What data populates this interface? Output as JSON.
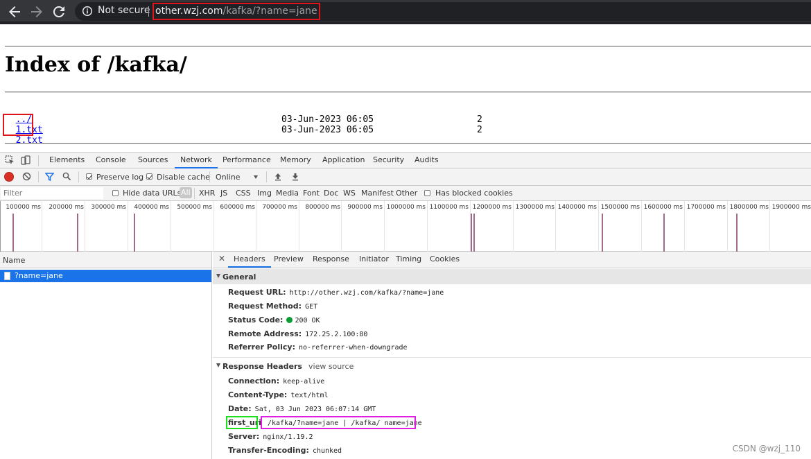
{
  "browser": {
    "security_label": "Not secure",
    "url_host": "other.wzj.com",
    "url_path": "/kafka/?name=jane",
    "icons": [
      "back-arrow-icon",
      "forward-arrow-icon",
      "reload-icon",
      "info-icon"
    ]
  },
  "page": {
    "heading": "Index of /kafka/",
    "entries": [
      {
        "name": "../",
        "date": "",
        "size": ""
      },
      {
        "name": "1.txt",
        "date": "03-Jun-2023 06:05",
        "size": "2"
      },
      {
        "name": "2.txt",
        "date": "03-Jun-2023 06:05",
        "size": "2"
      }
    ]
  },
  "devtools": {
    "tabs": [
      "Elements",
      "Console",
      "Sources",
      "Network",
      "Performance",
      "Memory",
      "Application",
      "Security",
      "Audits"
    ],
    "active_tab": "Network",
    "toolbar": {
      "preserve_log": "Preserve log",
      "preserve_log_checked": true,
      "disable_cache": "Disable cache",
      "disable_cache_checked": true,
      "throttle": "Online"
    },
    "filter": {
      "placeholder": "Filter",
      "hide_data_urls": "Hide data URLs",
      "types": [
        "All",
        "XHR",
        "JS",
        "CSS",
        "Img",
        "Media",
        "Font",
        "Doc",
        "WS",
        "Manifest",
        "Other"
      ],
      "active_type": "All",
      "has_blocked_cookies": "Has blocked cookies"
    },
    "timeline": {
      "labels": [
        "100000 ms",
        "200000 ms",
        "300000 ms",
        "400000 ms",
        "500000 ms",
        "600000 ms",
        "700000 ms",
        "800000 ms",
        "900000 ms",
        "1000000 ms",
        "1100000 ms",
        "1200000 ms",
        "1300000 ms",
        "1400000 ms",
        "1500000 ms",
        "1600000 ms",
        "1700000 ms",
        "1800000 ms",
        "1900000 ms"
      ]
    },
    "name_column": "Name",
    "request": "?name=jane",
    "detail_tabs": [
      "Headers",
      "Preview",
      "Response",
      "Initiator",
      "Timing",
      "Cookies"
    ],
    "active_detail_tab": "Headers",
    "general": {
      "title": "General",
      "rows": [
        {
          "key": "Request URL:",
          "value": "http://other.wzj.com/kafka/?name=jane"
        },
        {
          "key": "Request Method:",
          "value": "GET"
        },
        {
          "key": "Status Code:",
          "value": "200 OK"
        },
        {
          "key": "Remote Address:",
          "value": "172.25.2.100:80"
        },
        {
          "key": "Referrer Policy:",
          "value": "no-referrer-when-downgrade"
        }
      ]
    },
    "response_headers": {
      "title": "Response Headers",
      "view_source": "view source",
      "rows": [
        {
          "key": "Connection:",
          "value": "keep-alive"
        },
        {
          "key": "Content-Type:",
          "value": "text/html"
        },
        {
          "key": "Date:",
          "value": "Sat, 03 Jun 2023 06:07:14 GMT"
        },
        {
          "key": "first_uri",
          "value": "/kafka/?name=jane | /kafka/ name=jane"
        },
        {
          "key": "Server:",
          "value": "nginx/1.19.2"
        },
        {
          "key": "Transfer-Encoding:",
          "value": "chunked"
        }
      ]
    }
  },
  "watermark": "CSDN @wzj_110",
  "colors": {
    "highlight_red": "#e0151c",
    "highlight_green": "#1ee01e",
    "highlight_magenta": "#e01ee0",
    "selection_blue": "#1a73e8"
  }
}
